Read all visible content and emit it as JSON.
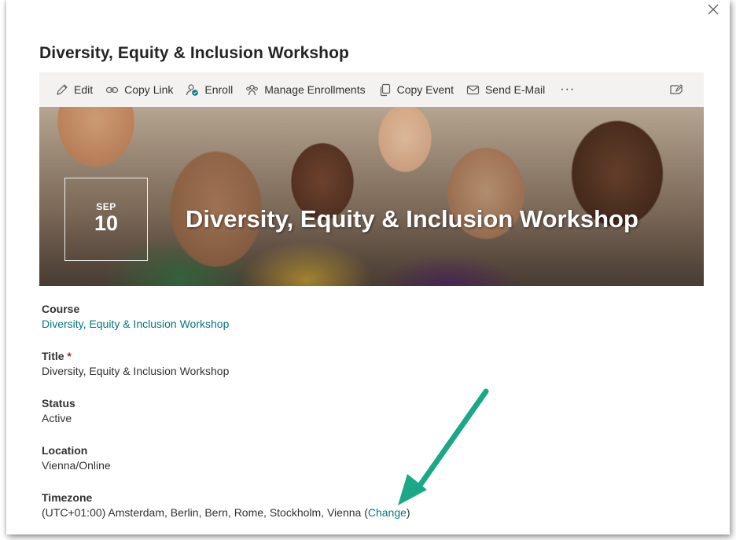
{
  "panel": {
    "title": "Diversity, Equity & Inclusion Workshop"
  },
  "toolbar": {
    "items": [
      {
        "label": "Edit",
        "icon": "pencil-icon"
      },
      {
        "label": "Copy Link",
        "icon": "link-icon"
      },
      {
        "label": "Enroll",
        "icon": "person-check-icon"
      },
      {
        "label": "Manage Enrollments",
        "icon": "people-icon"
      },
      {
        "label": "Copy Event",
        "icon": "copy-icon"
      },
      {
        "label": "Send E-Mail",
        "icon": "mail-icon"
      }
    ],
    "more": "···"
  },
  "hero": {
    "month": "SEP",
    "day": "10",
    "title": "Diversity, Equity & Inclusion Workshop"
  },
  "fields": {
    "course": {
      "label": "Course",
      "value": "Diversity, Equity & Inclusion Workshop"
    },
    "title": {
      "label": "Title",
      "required_mark": "*",
      "value": "Diversity, Equity & Inclusion Workshop"
    },
    "status": {
      "label": "Status",
      "value": "Active"
    },
    "location": {
      "label": "Location",
      "value": "Vienna/Online"
    },
    "timezone": {
      "label": "Timezone",
      "value_prefix": "(UTC+01:00) Amsterdam, Berlin, Bern, Rome, Stockholm, Vienna (",
      "change_link": "Change",
      "value_suffix": ")"
    }
  },
  "colors": {
    "link": "#03787c",
    "toolbar_bg": "#f3f2f1",
    "arrow": "#1aa886",
    "required": "#a4262c"
  }
}
